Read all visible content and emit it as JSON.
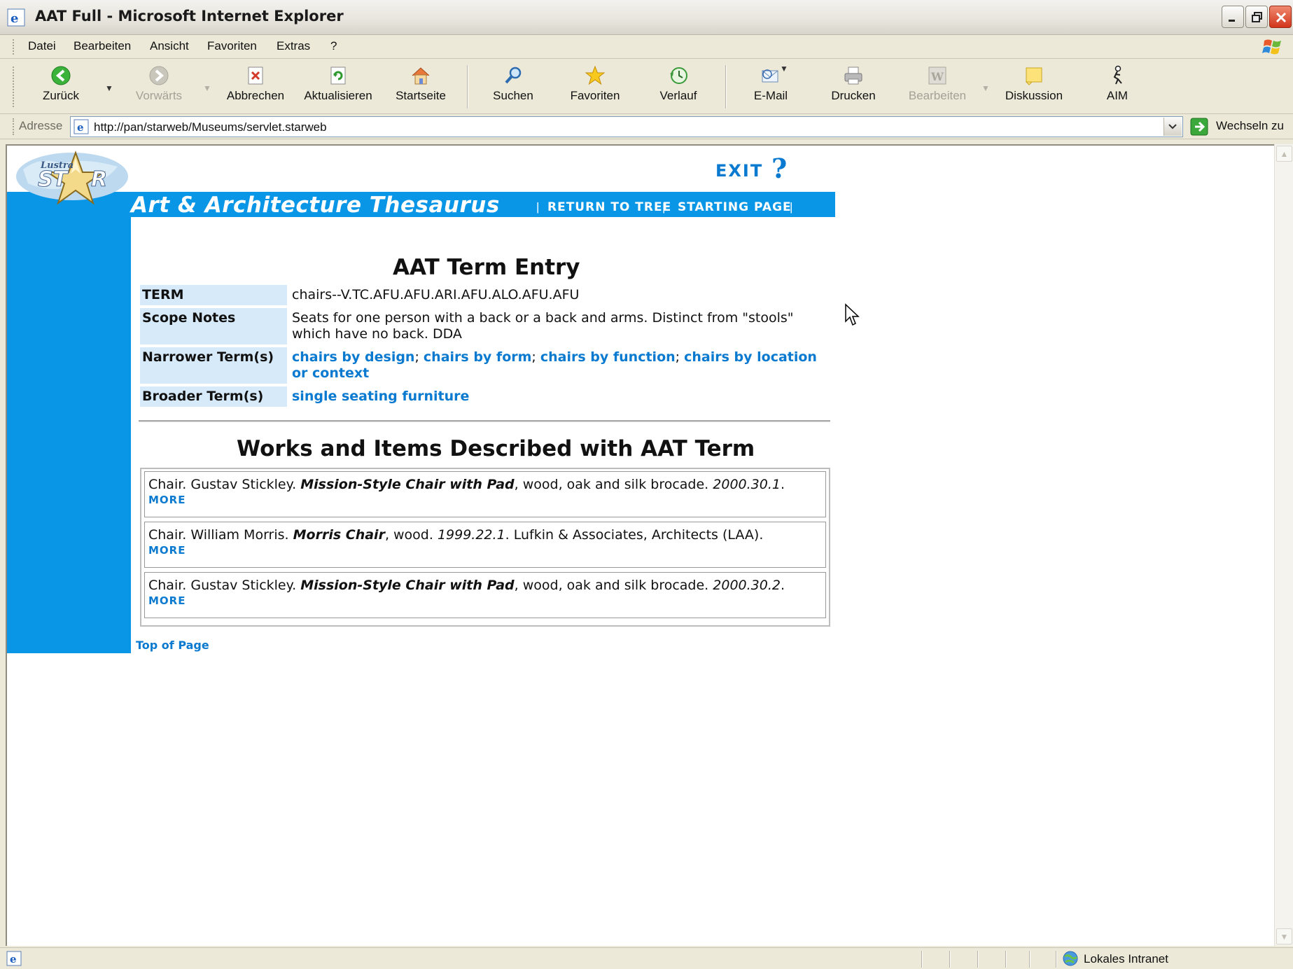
{
  "window": {
    "title": "AAT Full - Microsoft Internet Explorer"
  },
  "menu": [
    "Datei",
    "Bearbeiten",
    "Ansicht",
    "Favoriten",
    "Extras",
    "?"
  ],
  "toolbar": {
    "back": "Zurück",
    "forward": "Vorwärts",
    "stop": "Abbrechen",
    "refresh": "Aktualisieren",
    "home": "Startseite",
    "search": "Suchen",
    "favorites": "Favoriten",
    "history": "Verlauf",
    "mail": "E-Mail",
    "print": "Drucken",
    "edit": "Bearbeiten",
    "discuss": "Diskussion",
    "aim": "AIM"
  },
  "address": {
    "label": "Adresse",
    "url": "http://pan/starweb/Museums/servlet.starweb",
    "go": "Wechseln zu"
  },
  "page": {
    "site_title": "Art & Architecture Thesaurus",
    "nav": {
      "return_to_tree": "RETURN TO TREE",
      "starting_page": "STARTING PAGE",
      "sep": "|"
    },
    "exit": "EXIT",
    "help": "?",
    "entry_heading": "AAT Term Entry",
    "term_label": "TERM",
    "term_value": "chairs--V.TC.AFU.AFU.ARI.AFU.ALO.AFU.AFU",
    "scope_label": "Scope Notes",
    "scope_value": "Seats for one person with a back or a back and arms. Distinct from \"stools\" which have no back. DDA",
    "narrower_label": "Narrower Term(s)",
    "narrower": [
      "chairs by design",
      "chairs by form",
      "chairs by function",
      "chairs by location or context"
    ],
    "narrower_sep": ";",
    "broader_label": "Broader Term(s)",
    "broader": "single seating furniture",
    "works_heading": "Works and Items Described with AAT Term",
    "works": [
      {
        "pre": "Chair. Gustav Stickley. ",
        "title": "Mission-Style Chair with Pad",
        "mid": ", wood, oak and silk brocade. ",
        "acc": "2000.30.1",
        "post": ".",
        "more": "MORE"
      },
      {
        "pre": "Chair. William Morris. ",
        "title": "Morris Chair",
        "mid": ", wood. ",
        "acc": "1999.22.1",
        "post": ". Lufkin & Associates, Architects (LAA).",
        "more": "MORE"
      },
      {
        "pre": "Chair. Gustav Stickley. ",
        "title": "Mission-Style Chair with Pad",
        "mid": ", wood, oak and silk brocade. ",
        "acc": "2000.30.2",
        "post": ".",
        "more": "MORE"
      }
    ],
    "top_of_page": "Top of Page"
  },
  "status": {
    "zone": "Lokales Intranet"
  }
}
